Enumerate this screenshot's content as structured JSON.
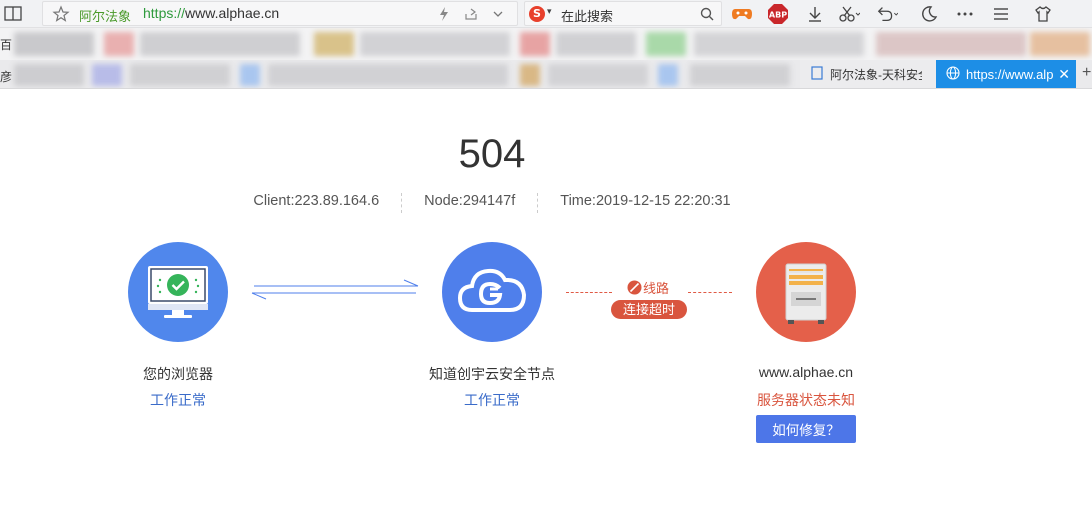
{
  "browser": {
    "address_bar": {
      "site_name": "阿尔法象",
      "url_scheme": "https://",
      "url_host": "www.alphae.cn"
    },
    "search": {
      "placeholder": "在此搜索"
    },
    "bookmarks_partial": "百",
    "tabs_partial": "彦",
    "tabs": [
      {
        "label": "阿尔法象-天科安全",
        "active": false
      },
      {
        "label": "https://www.alphae.cn",
        "active": true
      }
    ],
    "icons": [
      "sidebar-icon",
      "star-icon",
      "lightning-icon",
      "share-icon",
      "chevron-down-icon",
      "search-engine-icon",
      "search-icon",
      "game-icon",
      "adblock-icon",
      "download-icon",
      "scissors-icon",
      "undo-icon",
      "moon-icon",
      "more-icon",
      "menu-icon",
      "shirt-icon"
    ],
    "adblock_label": "ABP"
  },
  "error": {
    "code": "504",
    "client": "Client:223.89.164.6",
    "node": "Node:294147f",
    "time": "Time:2019-12-15 22:20:31"
  },
  "nodes": {
    "browser": {
      "name": "您的浏览器",
      "status": "工作正常"
    },
    "cdn": {
      "name": "知道创宇云安全节点",
      "status": "工作正常"
    },
    "server": {
      "name": "www.alphae.cn",
      "status": "服务器状态未知",
      "fix_button": "如何修复？"
    }
  },
  "link": {
    "label": "线路",
    "badge": "连接超时"
  },
  "colors": {
    "accent_blue": "#4f7feb",
    "error_red": "#d9553e",
    "active_tab": "#1d8ee6"
  }
}
